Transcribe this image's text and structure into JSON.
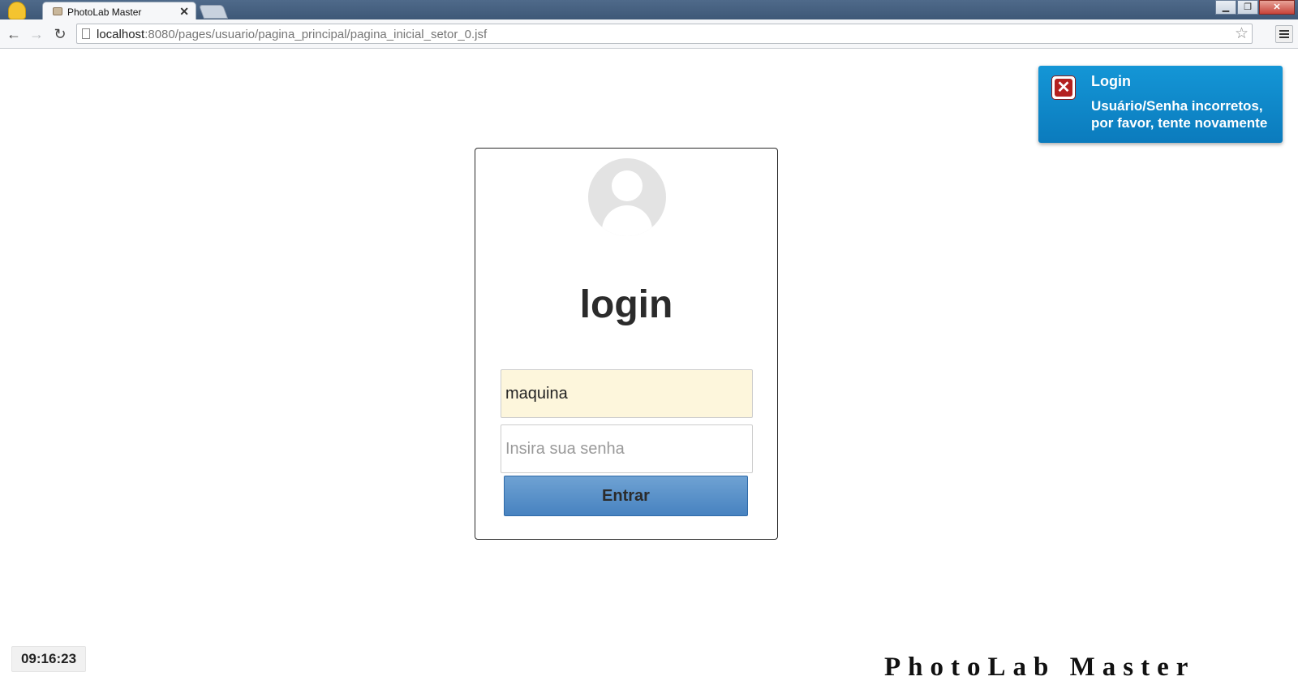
{
  "browser": {
    "tab": {
      "title": "PhotoLab Master",
      "close_glyph": "✕"
    },
    "url": {
      "host": "localhost",
      "path": ":8080/pages/usuario/pagina_principal/pagina_inicial_setor_0.jsf"
    },
    "window_controls": {
      "minimize": "▁",
      "maximize": "❐",
      "close": "✕"
    },
    "nav": {
      "back": "←",
      "forward": "→",
      "reload": "↻",
      "bookmark": "☆"
    }
  },
  "login": {
    "title": "login",
    "username_value": "maquina",
    "password_placeholder": "Insira sua senha",
    "submit_label": "Entrar"
  },
  "notification": {
    "title": "Login",
    "message": "Usuário/Senha incorretos, por favor, tente novamente",
    "icon": "error-x-icon",
    "icon_glyph": "✕"
  },
  "footer": {
    "clock": "09:16:23",
    "brand": "PhotoLab Master"
  },
  "colors": {
    "notification_bg": "#0b7bbd",
    "button_bg": "#4782c0",
    "username_field_bg": "#fdf6dc",
    "error_icon": "#b3211f"
  }
}
